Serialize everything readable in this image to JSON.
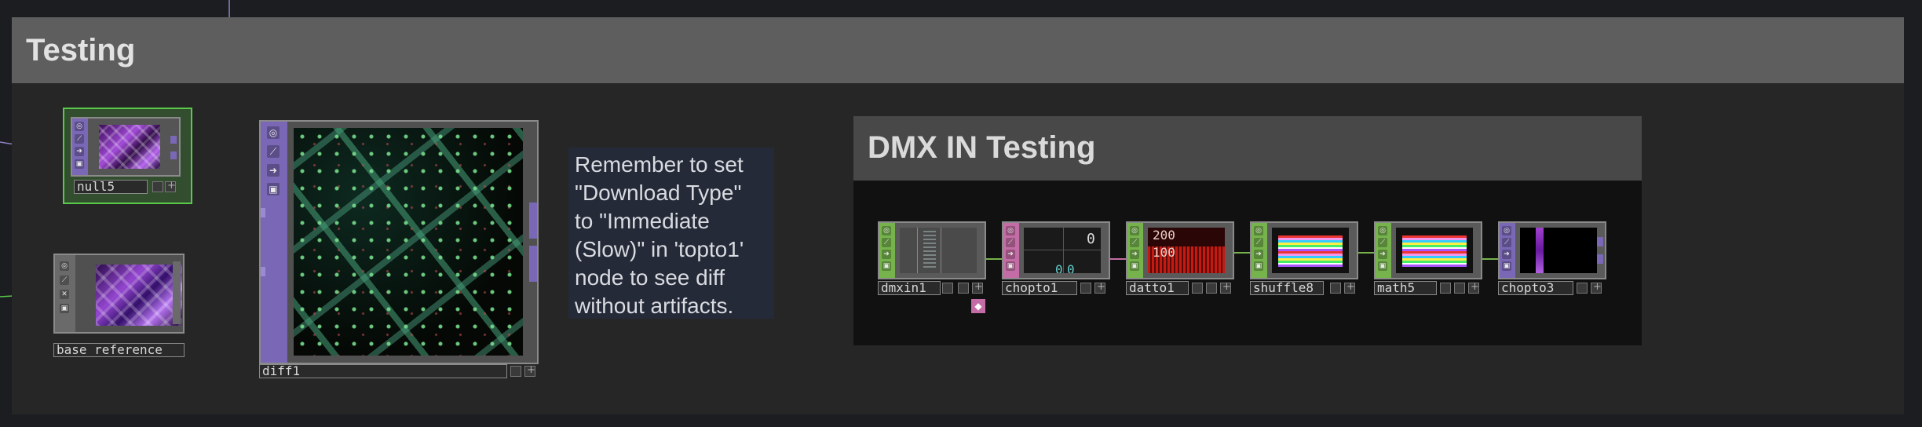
{
  "colors": {
    "background": "#1c1d21",
    "top_level_green": "#59c94a",
    "top_purple": "#7a68b6",
    "chop_pink": "#c46ca5",
    "dat_green": "#76b34c",
    "wire": "#8e82c4"
  },
  "annotations": {
    "testing_title": "Testing",
    "dmx_title": "DMX IN Testing"
  },
  "comment": {
    "lines": [
      "Remember to set",
      "\"Download Type\"",
      "to \"Immediate",
      "(Slow)\" in 'topto1'",
      "node to see diff",
      "without artifacts."
    ]
  },
  "nodes": {
    "null5": {
      "name": "null5",
      "family": "TOP",
      "icons": [
        "view-icon",
        "pin-icon",
        "arrow-icon",
        "lock-icon"
      ]
    },
    "base_reference": {
      "name": "base_reference",
      "family": "TOP",
      "icons": [
        "view-icon",
        "pin-icon",
        "bypass-icon",
        "lock-icon"
      ]
    },
    "diff1": {
      "name": "diff1",
      "family": "TOP",
      "icons": [
        "view-icon",
        "pin-icon",
        "arrow-icon",
        "lock-icon"
      ]
    },
    "dmxin1": {
      "name": "dmxin1",
      "family": "CHOP",
      "icons": [
        "view-icon",
        "pin-icon",
        "arrow-icon",
        "lock-icon"
      ]
    },
    "chopto1": {
      "name": "chopto1",
      "family": "DAT",
      "icons": [
        "view-icon",
        "pin-icon",
        "arrow-icon",
        "lock-icon"
      ],
      "cell_values": [
        "0",
        "0",
        "0"
      ]
    },
    "datto1": {
      "name": "datto1",
      "family": "CHOP",
      "icons": [
        "view-icon",
        "pin-icon",
        "arrow-icon",
        "lock-icon"
      ],
      "graph_values": [
        "200",
        "100"
      ]
    },
    "shuffle8": {
      "name": "shuffle8",
      "family": "CHOP",
      "icons": [
        "view-icon",
        "pin-icon",
        "arrow-icon",
        "lock-icon"
      ]
    },
    "math5": {
      "name": "math5",
      "family": "CHOP",
      "icons": [
        "view-icon",
        "pin-icon",
        "arrow-icon",
        "lock-icon"
      ]
    },
    "chopto3": {
      "name": "chopto3",
      "family": "TOP",
      "icons": [
        "view-icon",
        "pin-icon",
        "arrow-icon",
        "lock-icon"
      ]
    }
  }
}
